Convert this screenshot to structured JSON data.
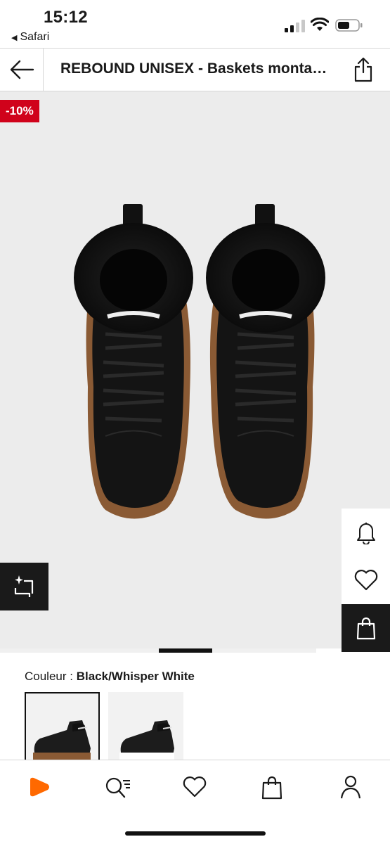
{
  "status_bar": {
    "time": "15:12",
    "back_app": "Safari",
    "back_icon": "back-triangle-icon"
  },
  "header": {
    "title": "REBOUND UNISEX - Baskets montantes - Black/Whisper White"
  },
  "product_image": {
    "discount": "-10%",
    "colors": {
      "badge": "#d0021b",
      "background": "#ececec"
    }
  },
  "color_section": {
    "label": "Couleur :",
    "value": "Black/Whisper White"
  },
  "bottom_nav": {
    "items": [
      {
        "name": "home",
        "icon": "zalando-logo-icon"
      },
      {
        "name": "search",
        "icon": "search-icon"
      },
      {
        "name": "wishlist",
        "icon": "heart-icon"
      },
      {
        "name": "bag",
        "icon": "bag-icon"
      },
      {
        "name": "account",
        "icon": "user-icon"
      }
    ]
  },
  "colors": {
    "accent": "#ff6900",
    "dark": "#1a1a1a"
  }
}
